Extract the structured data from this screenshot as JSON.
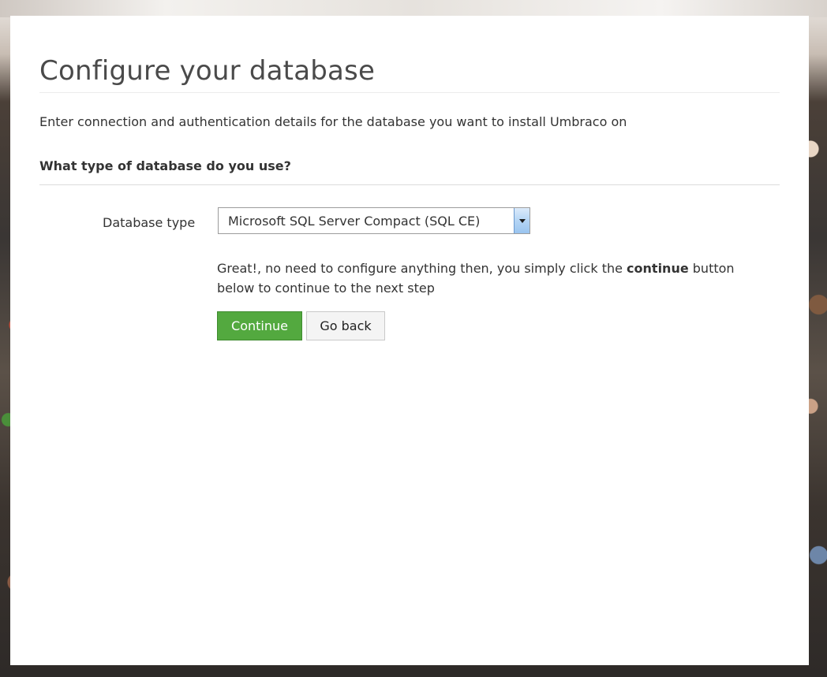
{
  "page": {
    "title": "Configure your database",
    "intro": "Enter connection and authentication details for the database you want to install Umbraco on",
    "question": "What type of database do you use?"
  },
  "form": {
    "database_type_label": "Database type",
    "database_type_value": "Microsoft SQL Server Compact (SQL CE)"
  },
  "note": {
    "before": "Great!, no need to configure anything then, you simply click the ",
    "emphasis": "continue",
    "after": " button below to continue to the next step"
  },
  "buttons": {
    "continue_label": "Continue",
    "go_back_label": "Go back"
  },
  "colors": {
    "continue": "#53a93f"
  },
  "icons": {
    "dropdown": "chevron-down-icon"
  }
}
